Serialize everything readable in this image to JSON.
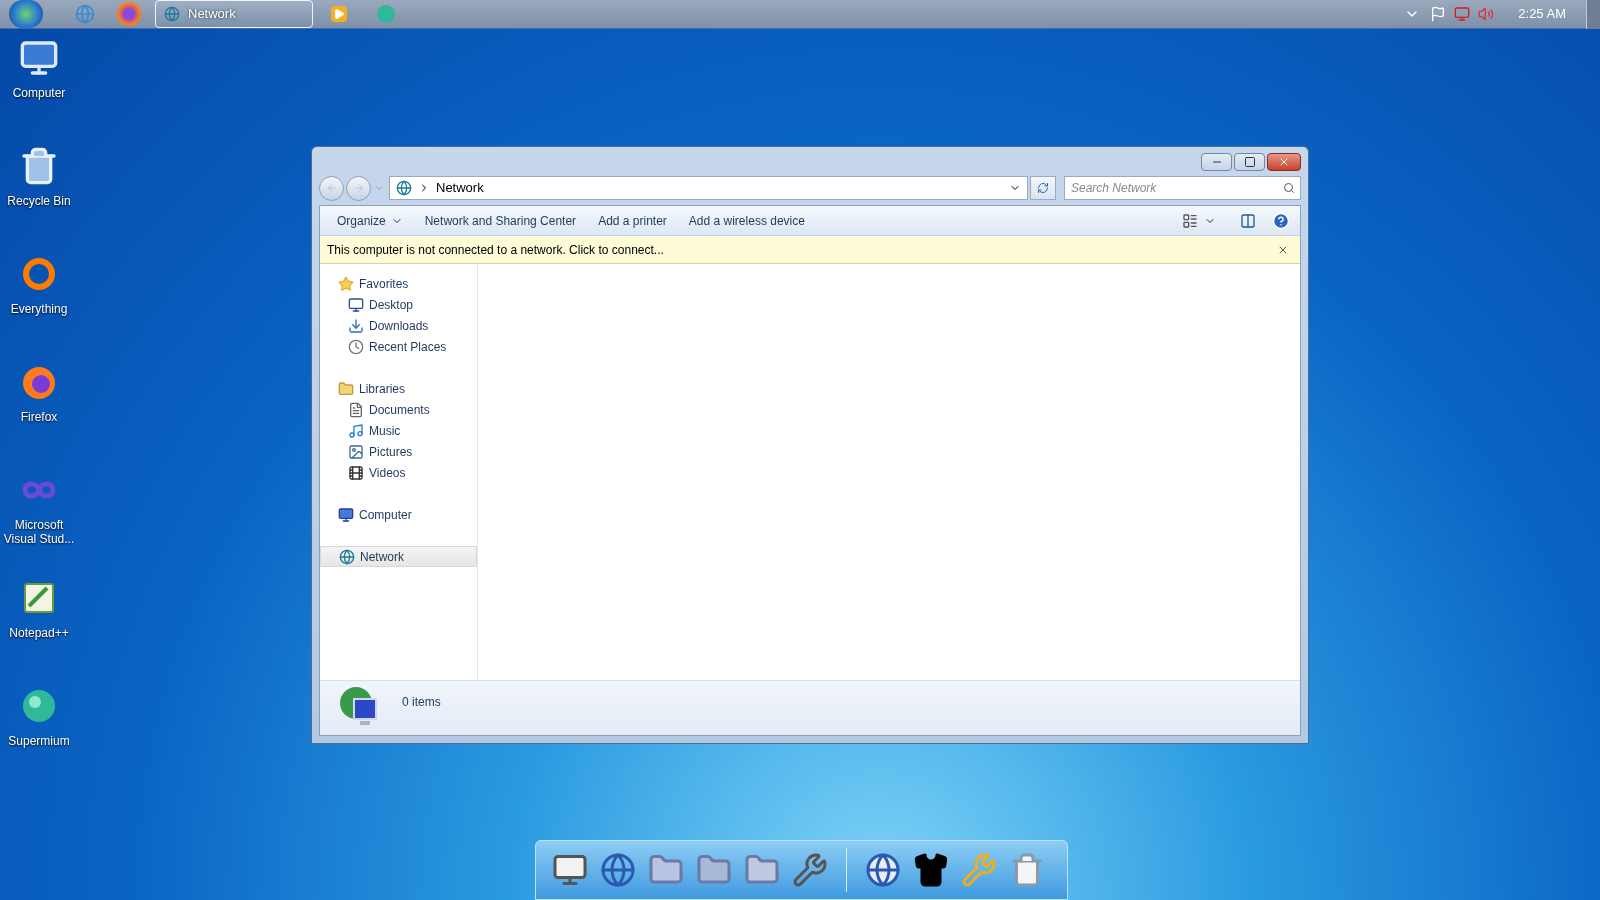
{
  "taskbar": {
    "tasks": [
      {
        "label": "Network",
        "selected": true
      }
    ],
    "clock": "2:25 AM"
  },
  "desktop_icons": [
    {
      "label": "Computer",
      "kind": "computer"
    },
    {
      "label": "Recycle Bin",
      "kind": "bin"
    },
    {
      "label": "Everything",
      "kind": "everything"
    },
    {
      "label": "Firefox",
      "kind": "firefox"
    },
    {
      "label": "Microsoft Visual Stud...",
      "kind": "vs"
    },
    {
      "label": "Notepad++",
      "kind": "notepad"
    },
    {
      "label": "Supermium",
      "kind": "supermium"
    }
  ],
  "window": {
    "address": "Network",
    "search": {
      "placeholder": "Search Network"
    },
    "toolbar": [
      {
        "label": "Organize",
        "kind": "menu"
      },
      {
        "label": "Network and Sharing Center",
        "kind": "plain"
      },
      {
        "label": "Add a printer",
        "kind": "plain"
      },
      {
        "label": "Add a wireless device",
        "kind": "plain"
      }
    ],
    "infobar": "This computer is not connected to a network. Click to connect...",
    "nav": [
      {
        "label": "Favorites",
        "kind": "star",
        "selected": false,
        "children": [
          {
            "label": "Desktop",
            "kind": "desktop",
            "selected": false
          },
          {
            "label": "Downloads",
            "kind": "downloads",
            "selected": false
          },
          {
            "label": "Recent Places",
            "kind": "recent",
            "selected": false
          }
        ]
      },
      {
        "label": "Libraries",
        "kind": "library",
        "selected": false,
        "children": [
          {
            "label": "Documents",
            "kind": "documents",
            "selected": false
          },
          {
            "label": "Music",
            "kind": "music",
            "selected": false
          },
          {
            "label": "Pictures",
            "kind": "pictures",
            "selected": false
          },
          {
            "label": "Videos",
            "kind": "videos",
            "selected": false
          }
        ]
      },
      {
        "label": "Computer",
        "kind": "computer",
        "selected": false
      },
      {
        "label": "Network",
        "kind": "network",
        "selected": true
      }
    ],
    "status": "0 items"
  }
}
